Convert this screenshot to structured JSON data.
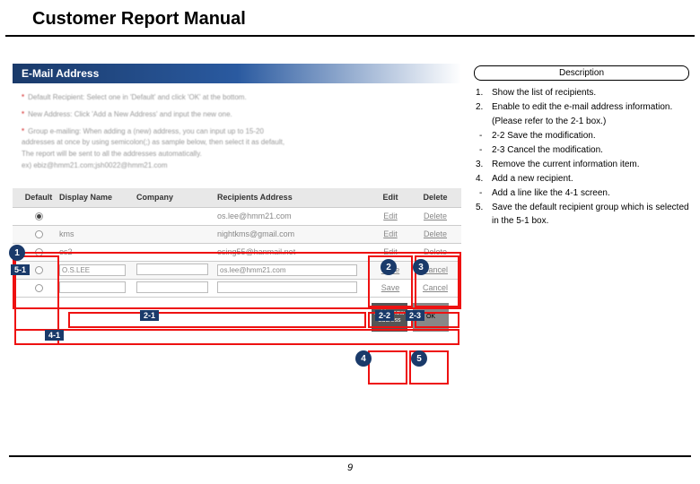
{
  "page_title": "Customer Report Manual",
  "page_number": "9",
  "email_header": "E-Mail Address",
  "instructions": {
    "line1": "Default Recipient: Select one in 'Default' and click 'OK' at the bottom.",
    "line2": "New Address: Click 'Add a New Address' and input the new one.",
    "line3a": "Group e-mailing: When adding a (new) address, you can input up to 15-20",
    "line3b": "addresses at once by using semicolon(;) as sample below, then select it as default,",
    "line3c": "The report will be sent to all the addresses automatically.",
    "line3d": "ex) ebiz@hmm21.com;jsh0022@hmm21.com"
  },
  "table": {
    "headers": {
      "default": "Default",
      "display": "Display Name",
      "company": "Company",
      "address": "Recipients Address",
      "edit": "Edit",
      "delete": "Delete"
    },
    "rows": [
      {
        "default_checked": true,
        "display": "",
        "company": "",
        "address": "os.lee@hmm21.com",
        "edit": "Edit",
        "delete": "Delete"
      },
      {
        "default_checked": false,
        "display": "kms",
        "company": "",
        "address": "nightkms@gmail.com",
        "edit": "Edit",
        "delete": "Delete"
      },
      {
        "default_checked": false,
        "display": "os2",
        "company": "",
        "address": "osing55@hanmail.net",
        "edit": "Edit",
        "delete": "Delete"
      }
    ],
    "edit_row": {
      "display": "O.S.LEE",
      "company": "",
      "address": "os.lee@hmm21.com",
      "save": "Save",
      "cancel": "Cancel"
    },
    "blank_row": {
      "save": "Save",
      "cancel": "Cancel"
    }
  },
  "footer": {
    "add_btn": "Add a new address",
    "ok_btn": "OK"
  },
  "description": {
    "title": "Description",
    "items": [
      {
        "type": "num",
        "num": "1.",
        "text": "Show the list of recipients."
      },
      {
        "type": "num",
        "num": "2.",
        "text": "Enable to edit the e-mail address information."
      },
      {
        "type": "cont",
        "text": "(Please refer to the 2-1 box.)"
      },
      {
        "type": "dash",
        "text": "2-2 Save the modification."
      },
      {
        "type": "dash",
        "text": "2-3 Cancel the modification."
      },
      {
        "type": "num",
        "num": "3.",
        "text": "Remove the current information item."
      },
      {
        "type": "num",
        "num": "4.",
        "text": "Add a new recipient."
      },
      {
        "type": "dash",
        "text": "Add a line like the 4-1 screen."
      },
      {
        "type": "num",
        "num": "5.",
        "text": "Save the default recipient group which is selected in the 5-1 box."
      }
    ]
  },
  "callouts": {
    "c1": "1",
    "c2": "2",
    "c3": "3",
    "c4": "4",
    "c5": "5",
    "c2_1": "2-1",
    "c2_2": "2-2",
    "c2_3": "2-3",
    "c4_1": "4-1",
    "c5_1": "5-1"
  }
}
